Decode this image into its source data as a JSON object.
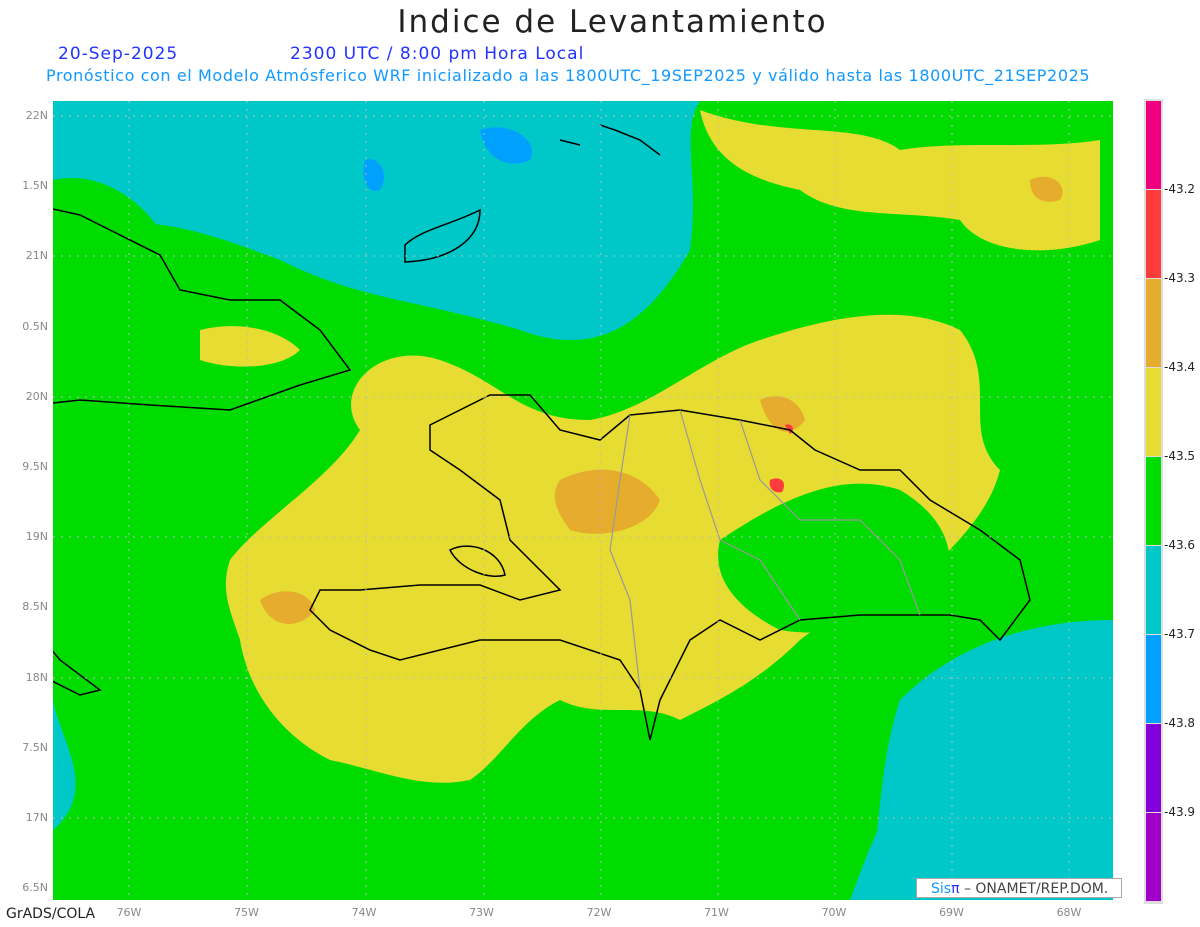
{
  "title": "Indice de Levantamiento",
  "date": "20-Sep-2025",
  "time": "2300 UTC / 8:00 pm Hora Local",
  "subtitle": "Pronóstico con el Modelo Atmósferico WRF inicializado a las 1800UTC_19SEP2025 y válido hasta las  1800UTC_21SEP2025",
  "footer_left": "GrADS/COLA",
  "credit": {
    "sis": "Sis",
    "pi": "π",
    "rest": " –  ONAMET/REP.DOM."
  },
  "lat_labels": [
    "22N",
    "1.5N",
    "21N",
    "0.5N",
    "20N",
    "9.5N",
    "19N",
    "8.5N",
    "18N",
    "7.5N",
    "17N",
    "6.5N"
  ],
  "lon_labels": [
    "76W",
    "75W",
    "74W",
    "73W",
    "72W",
    "71W",
    "70W",
    "69W",
    "68W"
  ],
  "colorbar": {
    "colors": [
      "#f0007e",
      "#ff3c3c",
      "#e6ac2e",
      "#e6dc32",
      "#00dc00",
      "#00c8c8",
      "#00a0ff",
      "#8200dc",
      "#a000c8"
    ],
    "labels": [
      "-43.2",
      "-43.3",
      "-43.4",
      "-43.5",
      "-43.6",
      "-43.7",
      "-43.8",
      "-43.9"
    ]
  }
}
